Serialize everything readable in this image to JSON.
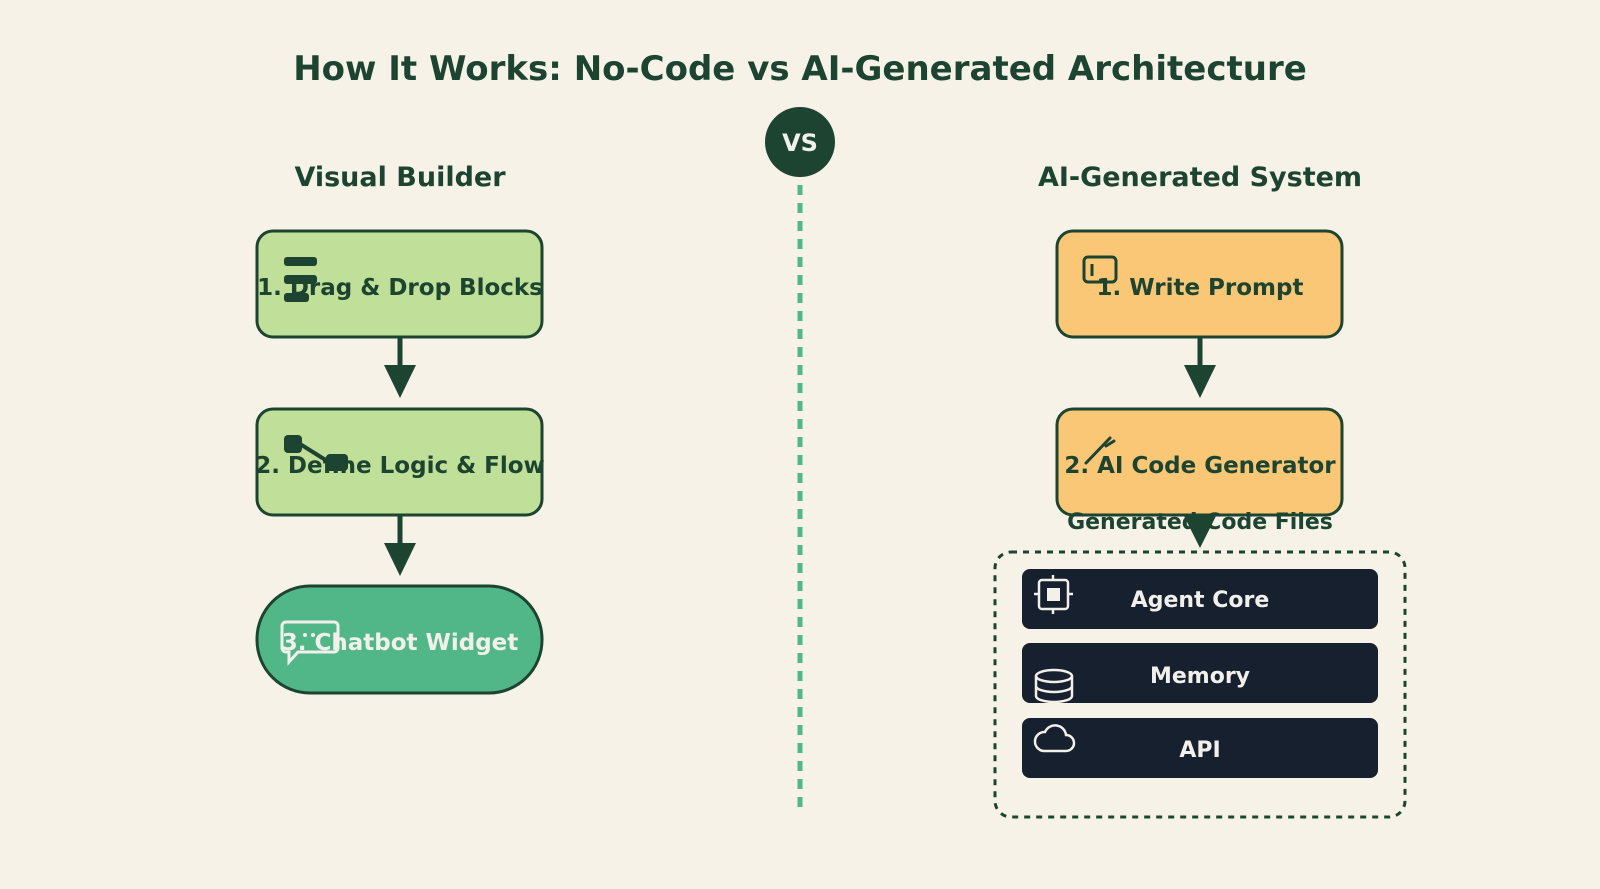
{
  "title": "How It Works: No-Code vs AI-Generated Architecture",
  "vs_label": "VS",
  "left": {
    "heading": "Visual Builder",
    "steps": [
      {
        "label": "1. Drag & Drop Blocks",
        "icon": "blocks-icon"
      },
      {
        "label": "2. Define Logic & Flow",
        "icon": "flow-icon"
      },
      {
        "label": "3. Chatbot Widget",
        "icon": "chat-bubble-icon"
      }
    ]
  },
  "right": {
    "heading": "AI-Generated System",
    "steps": [
      {
        "label": "1. Write Prompt",
        "icon": "terminal-icon"
      },
      {
        "label": "2. AI Code Generator",
        "icon": "wand-icon"
      }
    ],
    "files_group": {
      "label": "Generated Code Files",
      "items": [
        {
          "label": "Agent Core",
          "icon": "chip-icon"
        },
        {
          "label": "Memory",
          "icon": "database-icon"
        },
        {
          "label": "API",
          "icon": "cloud-icon"
        }
      ]
    }
  },
  "colors": {
    "background": "#f6f2e8",
    "dark_green": "#1c4430",
    "light_green": "#c0df98",
    "mid_green": "#52b788",
    "orange": "#f9c775",
    "navy": "#17202e",
    "divider": "#52b788"
  }
}
